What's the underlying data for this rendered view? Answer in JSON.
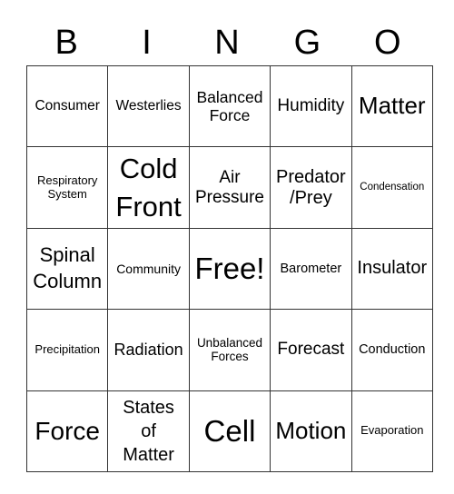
{
  "header": {
    "letters": [
      "B",
      "I",
      "N",
      "G",
      "O"
    ]
  },
  "card": {
    "rows": [
      [
        "Consumer",
        "Westerlies",
        "Balanced Force",
        "Humidity",
        "Matter"
      ],
      [
        "Respiratory System",
        "Cold Front",
        "Air Pressure",
        "Predator /Prey",
        "Condensation"
      ],
      [
        "Spinal Column",
        "Community",
        "Free!",
        "Barometer",
        "Insulator"
      ],
      [
        "Precipitation",
        "Radiation",
        "Unbalanced Forces",
        "Forecast",
        "Conduction"
      ],
      [
        "Force",
        "States of Matter",
        "Cell",
        "Motion",
        "Evaporation"
      ]
    ]
  }
}
